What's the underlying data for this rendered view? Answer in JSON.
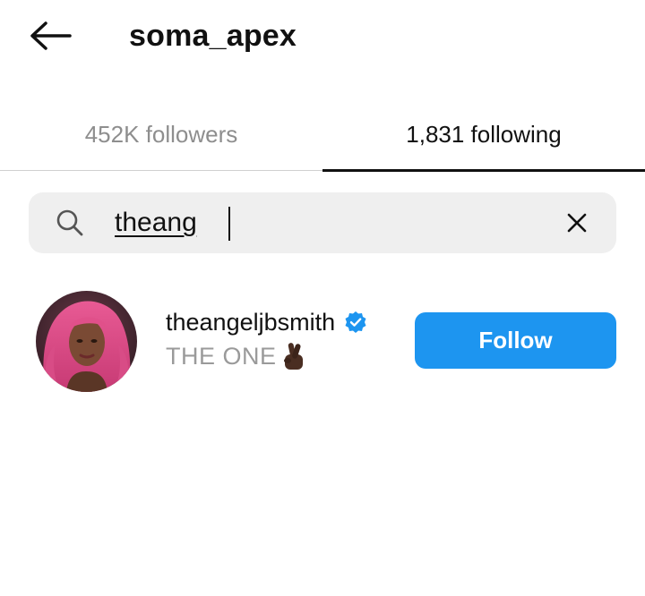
{
  "header": {
    "title": "soma_apex",
    "back_icon": "arrow-left-icon"
  },
  "tabs": [
    {
      "label": "452K followers",
      "active": false
    },
    {
      "label": "1,831 following",
      "active": true
    }
  ],
  "search": {
    "value": "theang",
    "search_icon": "search-icon",
    "clear_icon": "close-icon"
  },
  "results": [
    {
      "username": "theangeljbsmith",
      "verified": true,
      "subtitle": "THE ONE",
      "subtitle_emoji": "crossed-fingers-icon",
      "follow_label": "Follow"
    }
  ],
  "colors": {
    "accent": "#1d95f0",
    "verified": "#1d95f0",
    "muted_text": "#8e8e8e",
    "search_bg": "#efefef"
  }
}
